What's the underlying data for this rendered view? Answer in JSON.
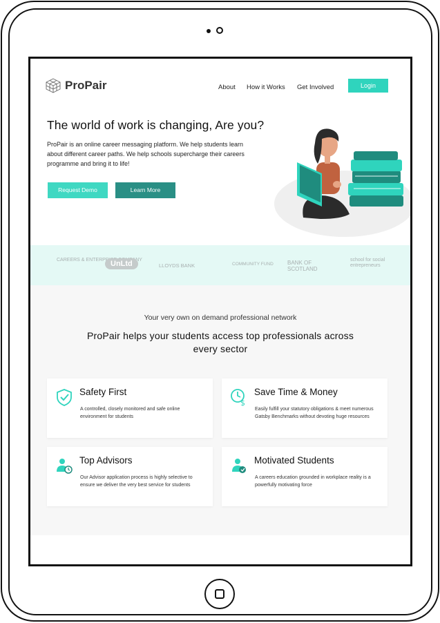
{
  "nav": {
    "brand": "ProPair",
    "links": [
      "About",
      "How it Works",
      "Get Involved"
    ],
    "login_label": "Login"
  },
  "hero": {
    "title": "The world of work is changing, Are you?",
    "description": "ProPair is an online career messaging platform.  We help students learn about different career paths. We help schools supercharge their careers programme and bring it to life!",
    "demo_label": "Request Demo",
    "more_label": "Learn More"
  },
  "partners": [
    {
      "name": "CAREERS & ENTERPRISE COMPANY"
    },
    {
      "name": "UnLtd"
    },
    {
      "name": "LLOYDS BANK"
    },
    {
      "name": "COMMUNITY FUND"
    },
    {
      "name": "BANK OF SCOTLAND"
    },
    {
      "name": "school for social entrepreneurs"
    }
  ],
  "network": {
    "subheading": "Your very own on demand professional network",
    "heading": "ProPair helps your students access top professionals across every sector"
  },
  "features": [
    {
      "title": "Safety First",
      "description": "A controlled, closely monitored and safe online environment for students",
      "icon": "shield-check-icon"
    },
    {
      "title": "Save Time & Money",
      "description": "Easily fulfill your statutory obligations & meet numerous Gatsby Benchmarks without devoting huge resources",
      "icon": "clock-dollar-icon"
    },
    {
      "title": "Top Advisors",
      "description": "Our Advisor application process is highly selective to ensure we deliver the very best service for students",
      "icon": "advisor-clock-icon"
    },
    {
      "title": "Motivated Students",
      "description": "A careers education grounded in workplace reality is a powerfully motivating force",
      "icon": "student-badge-icon"
    }
  ],
  "colors": {
    "accent": "#2fd4bd",
    "dark_accent": "#2a8f85",
    "band": "#e4f9f5"
  }
}
